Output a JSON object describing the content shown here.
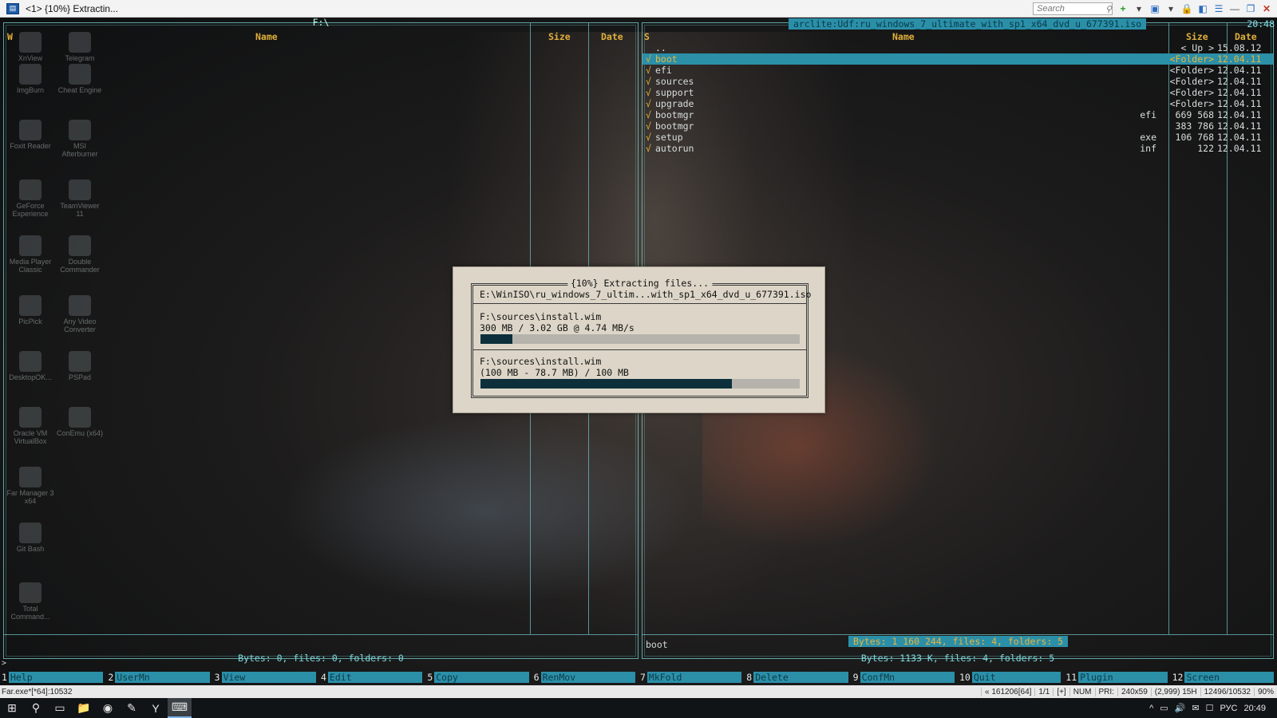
{
  "window": {
    "title": "<1> {10%} Extractin...",
    "search_placeholder": "Search",
    "buttons": [
      "+",
      "▾",
      "▣",
      "▾",
      "🔒",
      "◧",
      "☰",
      "—",
      "❐",
      "✕"
    ]
  },
  "left_panel": {
    "path": "F:\\",
    "corner": "W",
    "columns": {
      "name": "Name",
      "size": "Size",
      "date": "Date"
    },
    "footer": "Bytes: 0, files: 0, folders: 0"
  },
  "right_panel": {
    "path": "arclite:Udf:ru_windows_7_ultimate_with_sp1_x64_dvd_u_677391.iso",
    "clock": "20:48",
    "corner": "S",
    "columns": {
      "name": "Name",
      "size": "Size",
      "date": "Date"
    },
    "parent": {
      "name": "..",
      "size": "< Up >",
      "date": "15.08.12"
    },
    "rows": [
      {
        "check": "√",
        "name": "boot",
        "ext": "",
        "size": "<Folder>",
        "date": "12.04.11",
        "selected": true
      },
      {
        "check": "√",
        "name": "efi",
        "ext": "",
        "size": "<Folder>",
        "date": "12.04.11",
        "selected": false
      },
      {
        "check": "√",
        "name": "sources",
        "ext": "",
        "size": "<Folder>",
        "date": "12.04.11",
        "selected": false
      },
      {
        "check": "√",
        "name": "support",
        "ext": "",
        "size": "<Folder>",
        "date": "12.04.11",
        "selected": false
      },
      {
        "check": "√",
        "name": "upgrade",
        "ext": "",
        "size": "<Folder>",
        "date": "12.04.11",
        "selected": false
      },
      {
        "check": "√",
        "name": "bootmgr",
        "ext": "efi",
        "size": "669 568",
        "date": "12.04.11",
        "selected": false
      },
      {
        "check": "√",
        "name": "bootmgr",
        "ext": "",
        "size": "383 786",
        "date": "12.04.11",
        "selected": false
      },
      {
        "check": "√",
        "name": "setup",
        "ext": "exe",
        "size": "106 768",
        "date": "12.04.11",
        "selected": false
      },
      {
        "check": "√",
        "name": "autorun",
        "ext": "inf",
        "size": "122",
        "date": "12.04.11",
        "selected": false
      }
    ],
    "status_name": "boot",
    "selected_info": "Bytes: 1 160 244, files: 4, folders: 5",
    "footer": "Bytes: 1133 K, files: 4, folders: 5"
  },
  "dialog": {
    "title": "{10%} Extracting files...",
    "archive_path": "E:\\WinISO\\ru_windows_7_ultim...with_sp1_x64_dvd_u_677391.iso",
    "total": {
      "file": "F:\\sources\\install.wim",
      "progress_text": " 300 MB / 3.02 GB @ 4.74 MB/s",
      "fraction": 0.1
    },
    "current": {
      "file": "F:\\sources\\install.wim",
      "progress_text": "(100 MB - 78.7 MB) / 100 MB",
      "fraction": 0.787
    }
  },
  "command_line": ">",
  "keybar": [
    {
      "num": "1",
      "label": "Help"
    },
    {
      "num": "2",
      "label": "UserMn"
    },
    {
      "num": "3",
      "label": "View"
    },
    {
      "num": "4",
      "label": "Edit"
    },
    {
      "num": "5",
      "label": "Copy"
    },
    {
      "num": "6",
      "label": "RenMov"
    },
    {
      "num": "7",
      "label": "MkFold"
    },
    {
      "num": "8",
      "label": "Delete"
    },
    {
      "num": "9",
      "label": "ConfMn"
    },
    {
      "num": "10",
      "label": "Quit"
    },
    {
      "num": "11",
      "label": "Plugin"
    },
    {
      "num": "12",
      "label": "Screen"
    }
  ],
  "statusbar": {
    "left": "Far.exe*[*64]:10532",
    "cells": [
      "« 161206[64]",
      "1/1",
      "[+]",
      "NUM",
      "PRI:",
      "240x59",
      "(2,999) 15H",
      "12496/10532",
      "90%"
    ]
  },
  "taskbar": {
    "items": [
      "⊞",
      "⚲",
      "▭",
      "📁",
      "◉",
      "✎",
      "Y",
      "⌨"
    ],
    "tray": [
      "^",
      "▭",
      "🔊",
      "✉",
      "☐",
      "РУС"
    ],
    "clock": "20:49"
  },
  "desktop_icons": [
    "XnView",
    "Telegram",
    "ImgBurn",
    "Cheat Engine",
    "Foxit Reader",
    "MSI Afterburner",
    "GeForce Experience",
    "TeamViewer 11",
    "Media Player Classic",
    "Double Commander",
    "PicPick",
    "Any Video Converter",
    "DesktopOK...",
    "PSPad",
    "Oracle VM VirtualBox",
    "ConEmu (x64)",
    "Far Manager 3 x64",
    "Git Bash",
    "Total Command..."
  ]
}
